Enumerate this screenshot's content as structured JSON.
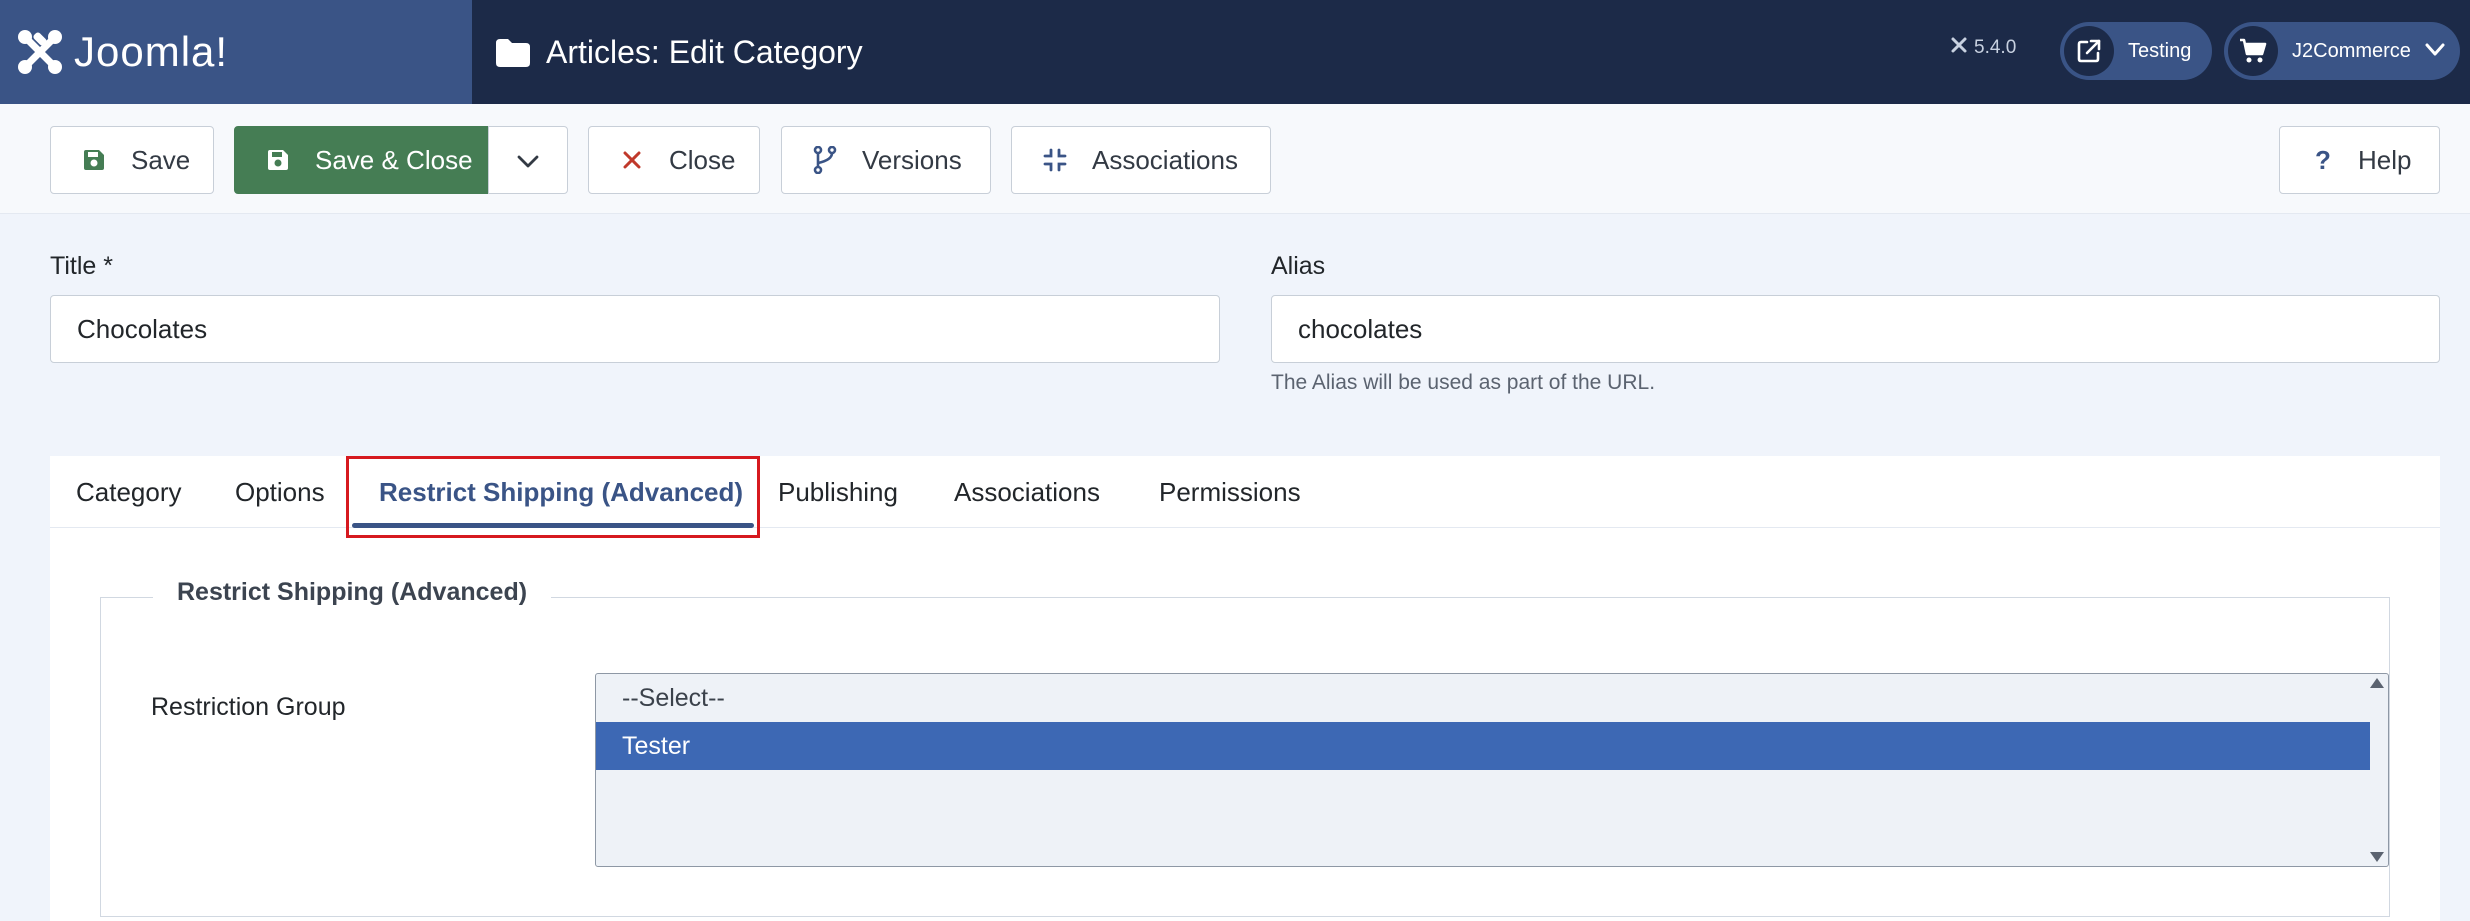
{
  "header": {
    "brand": "Joomla!",
    "page_title": "Articles: Edit Category",
    "version": "5.4.0",
    "site_link": "Testing",
    "user_menu": "J2Commerce"
  },
  "toolbar": {
    "save": "Save",
    "save_close": "Save & Close",
    "close": "Close",
    "versions": "Versions",
    "associations": "Associations",
    "help": "Help"
  },
  "form": {
    "title_label": "Title *",
    "title_value": "Chocolates",
    "alias_label": "Alias",
    "alias_value": "chocolates",
    "alias_hint": "The Alias will be used as part of the URL."
  },
  "tabs": [
    {
      "label": "Category",
      "active": false
    },
    {
      "label": "Options",
      "active": false
    },
    {
      "label": "Restrict Shipping (Advanced)",
      "active": true
    },
    {
      "label": "Publishing",
      "active": false
    },
    {
      "label": "Associations",
      "active": false
    },
    {
      "label": "Permissions",
      "active": false
    }
  ],
  "restrict_shipping": {
    "legend": "Restrict Shipping (Advanced)",
    "group_label": "Restriction Group",
    "options": [
      {
        "label": "--Select--",
        "selected": false
      },
      {
        "label": "Tester",
        "selected": true
      }
    ]
  },
  "colors": {
    "header_bg": "#1c2a48",
    "brand_bg": "#3a5486",
    "save_close_bg": "#457d54",
    "selected_option": "#3d68b4",
    "highlight_box": "#d6191f"
  }
}
